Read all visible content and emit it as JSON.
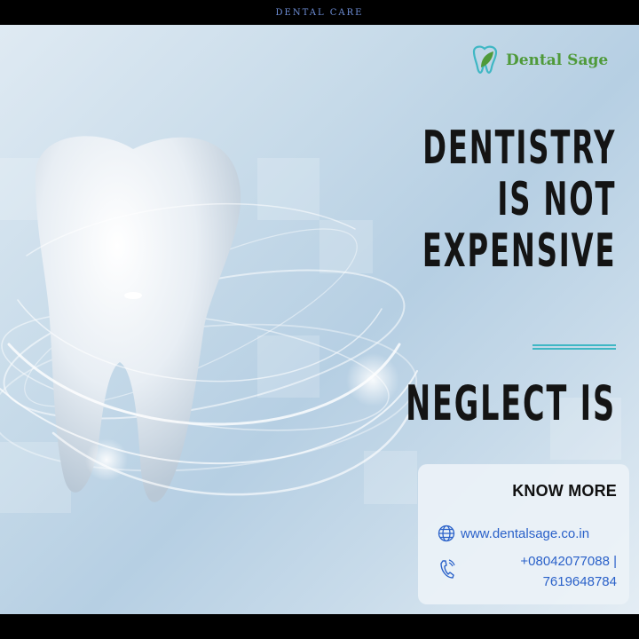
{
  "topbar": {
    "label": "DENTAL CARE"
  },
  "brand": {
    "name": "Dental Sage",
    "logo_icon": "tooth-leaf-icon",
    "color": "#4f9a3a"
  },
  "headline": {
    "line1": "DENTISTRY",
    "line2": "IS NOT",
    "line3": "EXPENSIVE",
    "tagline": "NEGLECT IS"
  },
  "hero_image": {
    "icon": "tooth-icon"
  },
  "card": {
    "title": "KNOW MORE",
    "website": "www.dentalsage.co.in",
    "website_icon": "globe-icon",
    "phone_line1": "+08042077088 |",
    "phone_line2": "7619648784",
    "phone_icon": "phone-icon"
  },
  "colors": {
    "accent": "#3fb7c4",
    "link": "#2a61c9",
    "text": "#141414",
    "topbar_text": "#6f8fd8"
  }
}
